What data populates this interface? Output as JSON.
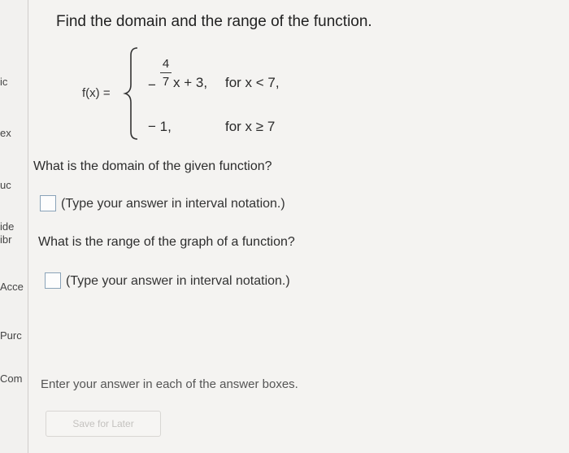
{
  "left_strip_fragments": [
    "ic",
    "ex",
    "uc",
    "ide",
    "ibr",
    "Acce",
    "Purc",
    "Com"
  ],
  "question": {
    "title": "Find the domain and the range of the function.",
    "function": {
      "lhs": "f(x) =",
      "piece1": {
        "sign": "−",
        "numerator": "4",
        "denominator": "7",
        "rest": "x + 3,",
        "condition": "for x < 7,"
      },
      "piece2": {
        "expr": "− 1,",
        "condition": "for x ≥ 7"
      }
    },
    "part1": {
      "prompt": "What is the domain of the given function?",
      "hint": "(Type your answer in interval notation.)",
      "answer": ""
    },
    "part2": {
      "prompt": "What is the range of the graph of a function?",
      "hint": "(Type your answer in interval notation.)",
      "answer": ""
    }
  },
  "footer_text": "Enter your answer in each of the answer boxes.",
  "save_label": "Save for Later"
}
